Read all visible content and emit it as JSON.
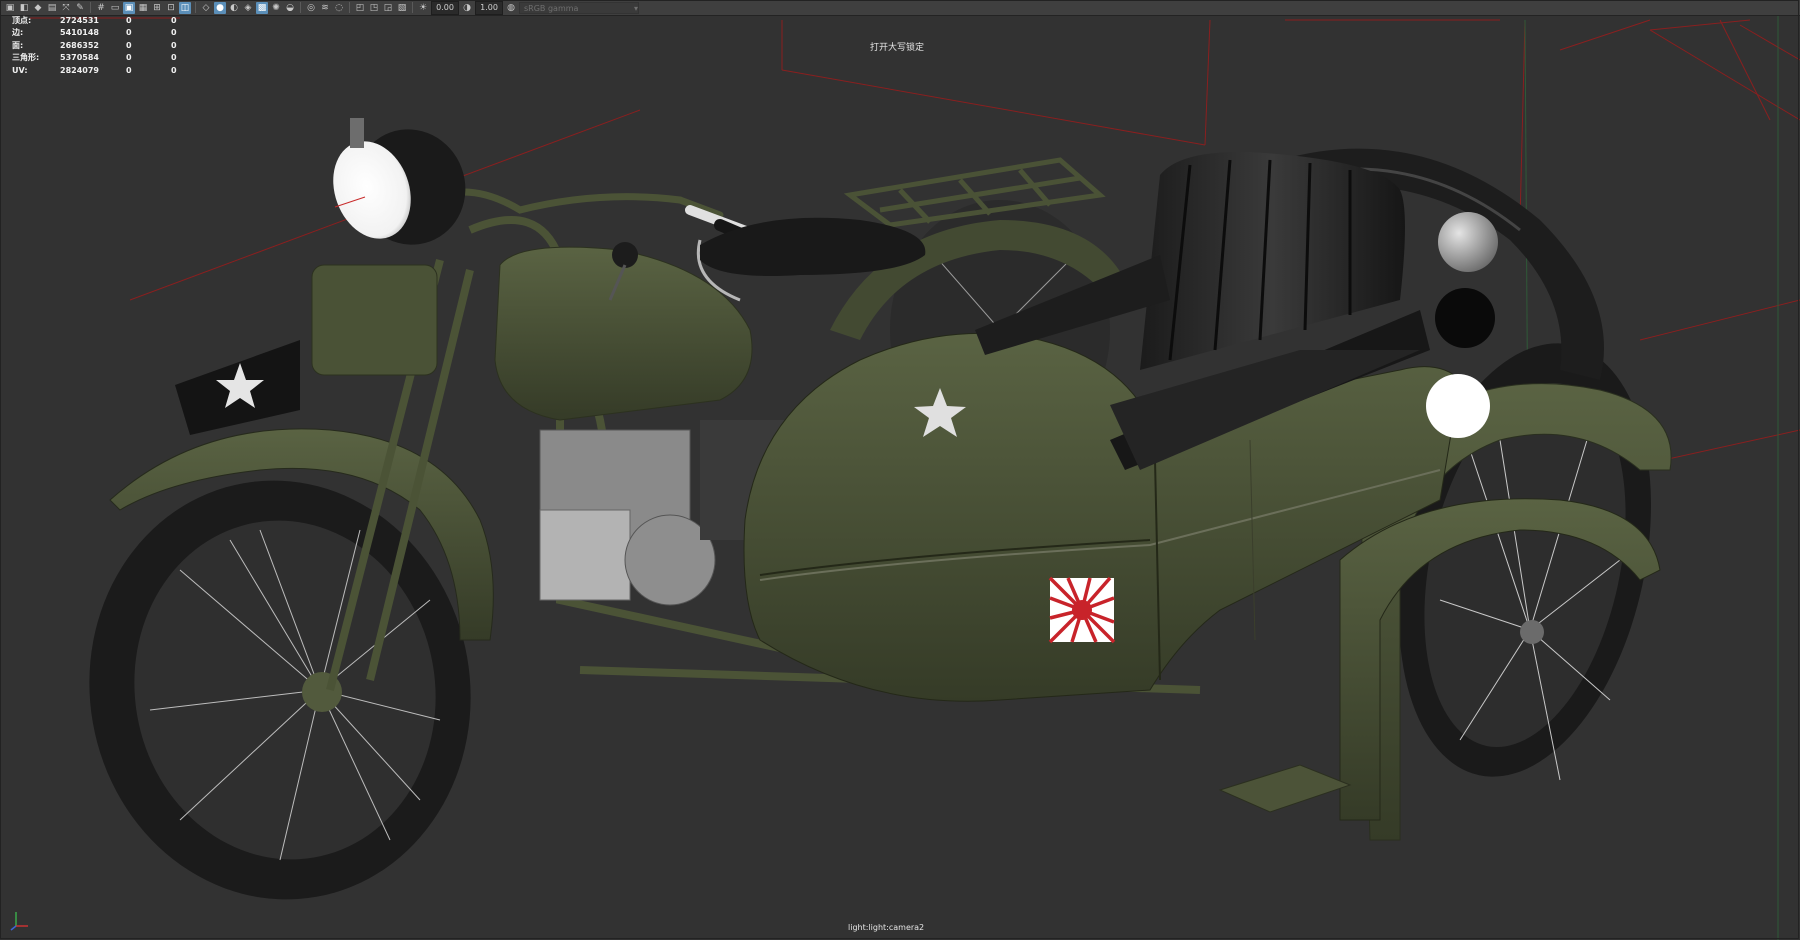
{
  "toolbar": {
    "value_a": "0.00",
    "value_b": "1.00",
    "camera_select": "sRGB gamma"
  },
  "hud": {
    "rows": [
      {
        "label": "顶点:",
        "v1": "2724531",
        "v2": "0",
        "v3": "0"
      },
      {
        "label": "边:",
        "v1": "5410148",
        "v2": "0",
        "v3": "0"
      },
      {
        "label": "面:",
        "v1": "2686352",
        "v2": "0",
        "v3": "0"
      },
      {
        "label": "三角形:",
        "v1": "5370584",
        "v2": "0",
        "v3": "0"
      },
      {
        "label": "UV:",
        "v1": "2824079",
        "v2": "0",
        "v3": "0"
      }
    ]
  },
  "viewport": {
    "caps_lock_message": "打开大写锁定",
    "camera_label": "light:light:camera2"
  },
  "colors": {
    "background": "#323232",
    "olive_body": "#4a5236",
    "olive_dark": "#363d28",
    "frustum_line": "#8a1f1f",
    "rising_sun_red": "#c8232a"
  }
}
